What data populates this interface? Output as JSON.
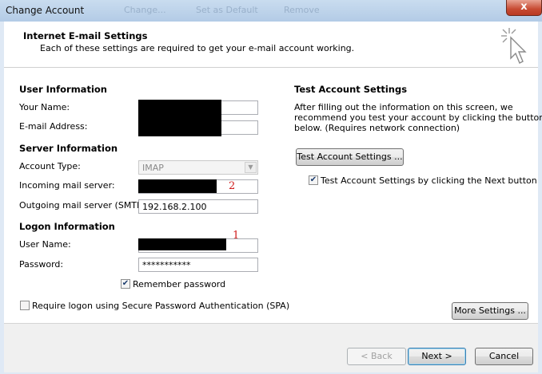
{
  "window": {
    "title": "Change Account",
    "background_tabs": [
      "Change...",
      "Set as Default",
      "Remove"
    ],
    "close_label": "x"
  },
  "header": {
    "title": "Internet E-mail Settings",
    "subtitle": "Each of these settings are required to get your e-mail account working."
  },
  "user_info": {
    "heading": "User Information",
    "your_name_label": "Your Name:",
    "email_label": "E-mail Address:"
  },
  "server_info": {
    "heading": "Server Information",
    "account_type_label": "Account Type:",
    "account_type_value": "IMAP",
    "incoming_label": "Incoming mail server:",
    "outgoing_label": "Outgoing mail server (SMTP):",
    "outgoing_value": "192.168.2.100"
  },
  "logon_info": {
    "heading": "Logon Information",
    "username_label": "User Name:",
    "password_label": "Password:",
    "password_value": "***********",
    "remember_label": "Remember password",
    "spa_label": "Require logon using Secure Password Authentication (SPA)"
  },
  "test_settings": {
    "heading": "Test Account Settings",
    "description": [
      "After filling out the information on this screen, we",
      "recommend you test your account by clicking the button",
      "below. (Requires network connection)"
    ],
    "test_button": "Test Account Settings ...",
    "next_checkbox_label": "Test Account Settings by clicking the Next button"
  },
  "annotations": {
    "marker1": "1",
    "marker2": "2"
  },
  "buttons": {
    "more_settings": "More Settings ...",
    "back": "< Back",
    "next": "Next >",
    "cancel": "Cancel"
  },
  "checkbox_state": {
    "remember_password": true,
    "spa": false,
    "test_on_next": true
  },
  "colors": {
    "annotation_red": "#d01c1c",
    "redaction": "#000000",
    "title_bar": "#b9d1ea"
  },
  "icons": [
    "wand-cursor-icon",
    "chevron-down-icon",
    "checkmark-icon"
  ]
}
